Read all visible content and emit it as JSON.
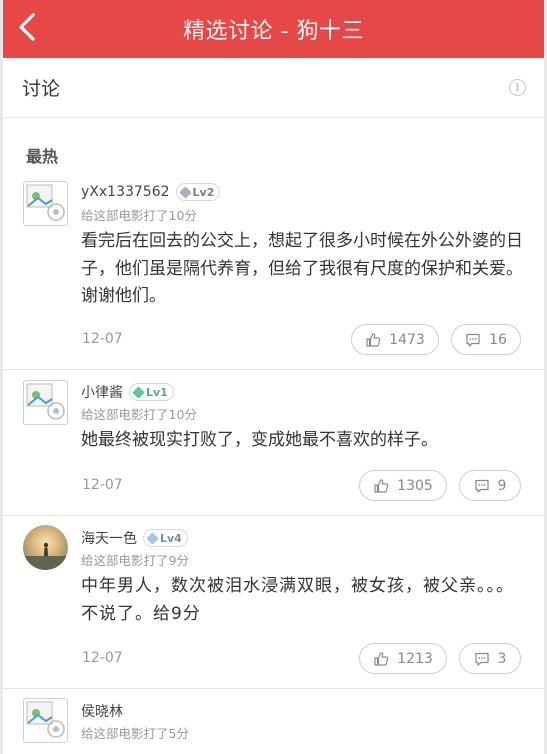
{
  "header": {
    "title": "精选讨论 - 狗十三"
  },
  "section": {
    "title": "讨论",
    "hot_label": "最热"
  },
  "colors": {
    "accent": "#e54847",
    "lv2": "#9aa4b2",
    "lv1": "#5ac8a8",
    "lv4": "#8fb3d9"
  },
  "comments": [
    {
      "username": "yXx1337562",
      "level": "Lv2",
      "avatar": "default-avatar-icon",
      "rating": "给这部电影打了10分",
      "content": "看完后在回去的公交上，想起了很多小时候在外公外婆的日子，他们虽是隔代养育，但给了我很有尺度的保护和关爱。谢谢他们。",
      "date": "12-07",
      "likes": "1473",
      "replies": "16"
    },
    {
      "username": "小律酱",
      "level": "Lv1",
      "avatar": "default-avatar-icon",
      "rating": "给这部电影打了10分",
      "content": "她最终被现实打败了，变成她最不喜欢的样子。",
      "date": "12-07",
      "likes": "1305",
      "replies": "9"
    },
    {
      "username": "海天一色",
      "level": "Lv4",
      "avatar": "photo-avatar",
      "rating": "给这部电影打了9分",
      "content": "中年男人，数次被泪水浸满双眼，被女孩，被父亲。。。不说了。给9分",
      "date": "12-07",
      "likes": "1213",
      "replies": "3"
    },
    {
      "username": "侯晓林",
      "avatar": "default-avatar-icon",
      "rating": "给这部电影打了5分"
    }
  ]
}
